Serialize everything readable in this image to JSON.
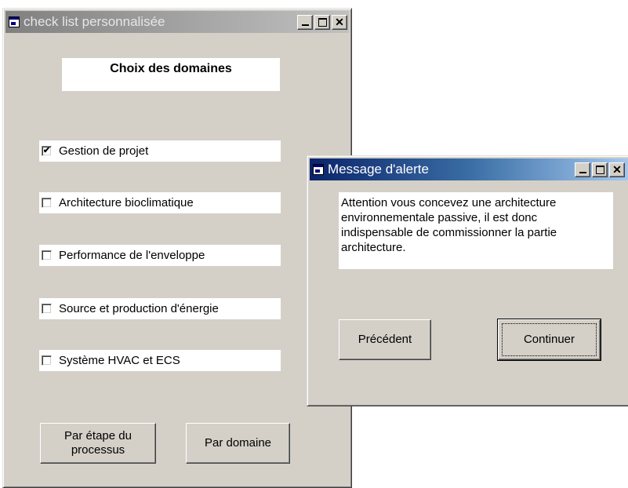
{
  "main_window": {
    "title": "check list personnalisée",
    "heading": "Choix des domaines",
    "checkboxes": [
      {
        "label": "Gestion de projet",
        "checked": true
      },
      {
        "label": "Architecture bioclimatique",
        "checked": false
      },
      {
        "label": "Performance de l'enveloppe",
        "checked": false
      },
      {
        "label": "Source et production d'énergie",
        "checked": false
      },
      {
        "label": "Système  HVAC et ECS",
        "checked": false
      }
    ],
    "buttons": {
      "by_step": "Par étape du processus",
      "by_domain": "Par domaine"
    }
  },
  "alert_dialog": {
    "title": "Message d'alerte",
    "message": "Attention vous concevez une architecture environnementale passive, il est donc indispensable de commissionner la partie architecture.",
    "buttons": {
      "previous": "Précédent",
      "continue": "Continuer"
    }
  },
  "icons": {
    "window_icon": "app-window-icon",
    "minimize": "minimize-icon",
    "maximize": "maximize-icon",
    "close": "close-icon",
    "check": "✔"
  }
}
